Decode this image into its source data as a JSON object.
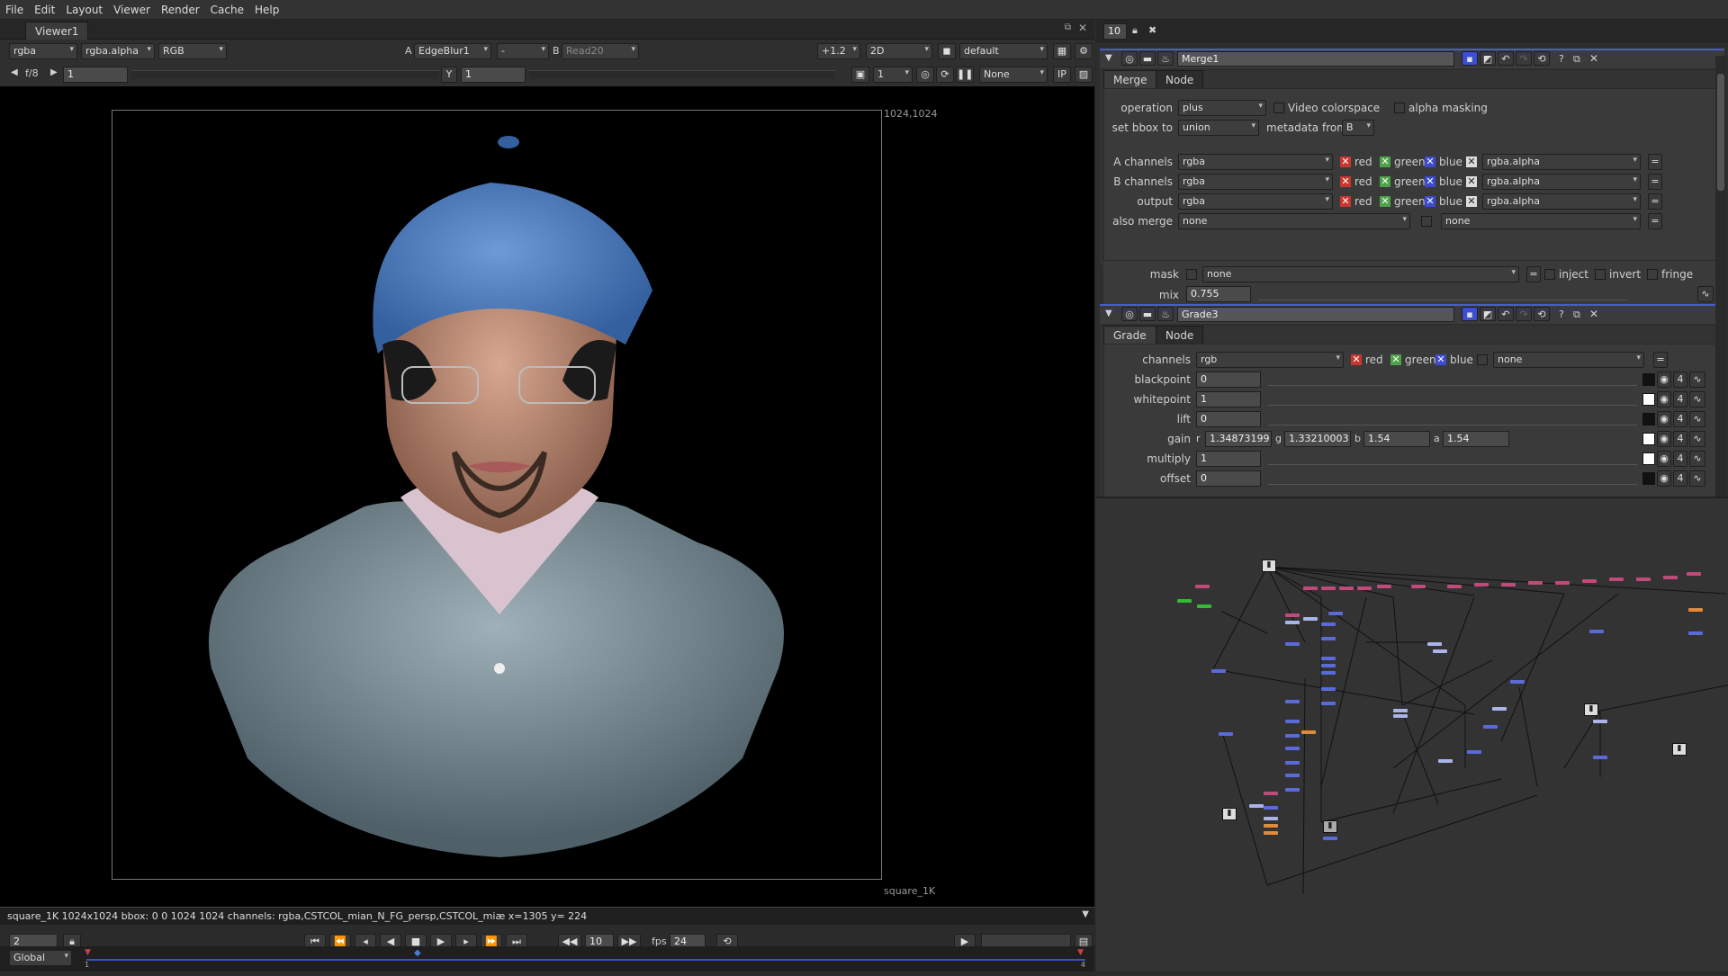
{
  "menu": [
    "File",
    "Edit",
    "Layout",
    "Viewer",
    "Render",
    "Cache",
    "Help"
  ],
  "viewer": {
    "tab": "Viewer1",
    "channels": "rgba",
    "alpha": "rgba.alpha",
    "display": "RGB",
    "a_label": "A",
    "a_input": "EdgeBlur1",
    "a_op": "-",
    "b_label": "B",
    "b_input": "Read20",
    "zoom": "+1.2",
    "mode": "2D",
    "lut": "default",
    "fstop": "f/8",
    "gain_val": "1",
    "y_label": "Y",
    "gamma_val": "1",
    "proxy": "1",
    "roi": "None",
    "ip": "IP",
    "corner_top_right": "1024,1024",
    "corner_bottom": "square_1K",
    "info": "square_1K 1024x1024  bbox: 0 0 1024 1024 channels: rgba,CSTCOL_mian_N_FG_persp,CSTCOL_miæ  x=1305 y= 224",
    "frame_in": "2",
    "current_frame": "10",
    "fps_label": "fps",
    "fps": "24",
    "global": "Global",
    "tl_start": "1",
    "tl_end": "4"
  },
  "properties": {
    "max_panels": "10",
    "merge": {
      "name": "Merge1",
      "tabs": [
        "Merge",
        "Node"
      ],
      "operation_label": "operation",
      "operation": "plus",
      "video_colorspace": "Video colorspace",
      "alpha_masking": "alpha masking",
      "bbox_label": "set bbox to",
      "bbox": "union",
      "metadata_label": "metadata from",
      "metadata": "B",
      "a_channels_label": "A channels",
      "b_channels_label": "B channels",
      "output_label": "output",
      "also_merge_label": "also merge",
      "rgba": "rgba",
      "red": "red",
      "green": "green",
      "blue": "blue",
      "alpha_ch": "rgba.alpha",
      "none": "none",
      "mask_label": "mask",
      "inject": "inject",
      "invert": "invert",
      "fringe": "fringe",
      "mix_label": "mix",
      "mix": "0.755"
    },
    "grade": {
      "name": "Grade3",
      "tabs": [
        "Grade",
        "Node"
      ],
      "channels_label": "channels",
      "channels": "rgb",
      "red": "red",
      "green": "green",
      "blue": "blue",
      "none": "none",
      "blackpoint_label": "blackpoint",
      "blackpoint": "0",
      "whitepoint_label": "whitepoint",
      "whitepoint": "1",
      "lift_label": "lift",
      "lift": "0",
      "gain_label": "gain",
      "gain_r_label": "r",
      "gain_r": "1.34873199",
      "gain_g_label": "g",
      "gain_g": "1.33210003",
      "gain_b_label": "b",
      "gain_b": "1.54",
      "gain_a_label": "a",
      "gain_a": "1.54",
      "multiply_label": "multiply",
      "multiply": "1",
      "offset_label": "offset",
      "offset": "0",
      "four": "4"
    }
  },
  "colors": {
    "accent": "#4a5bd0",
    "node_red": "#c04a7a",
    "node_blue": "#5a6ad8",
    "node_orange": "#e08a3a",
    "node_green": "#33bb33"
  }
}
